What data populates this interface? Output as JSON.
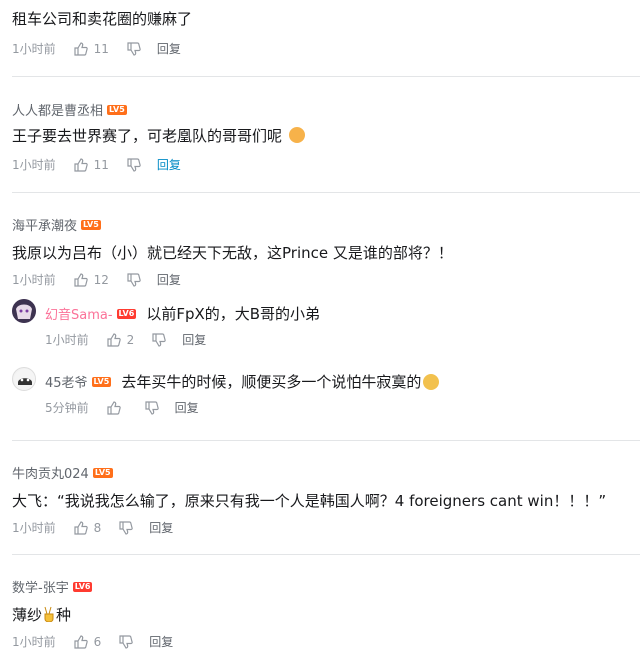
{
  "comments": [
    {
      "text": "租车公司和卖花圈的赚麻了",
      "time": "1小时前",
      "likes": "11",
      "reply": "回复"
    },
    {
      "username": "人人都是曹丞相",
      "level": "LV5",
      "text": "王子要去世界赛了，可老凰队的哥哥们呢",
      "time": "1小时前",
      "likes": "11",
      "reply": "回复"
    },
    {
      "username": "海平承潮夜",
      "level": "LV5",
      "text": "我原以为吕布（小）就已经天下无敌，这Prince 又是谁的部将？！",
      "time": "1小时前",
      "likes": "12",
      "reply": "回复",
      "replies": [
        {
          "username": "幻音Sama-",
          "level": "LV6",
          "text": "以前FpX的，大B哥的小弟",
          "time": "1小时前",
          "likes": "2",
          "reply": "回复"
        },
        {
          "username": "45老爷",
          "level": "LV5",
          "text": "去年买牛的时候，顺便买多一个说怕牛寂寞的",
          "time": "5分钟前",
          "reply": "回复"
        }
      ]
    },
    {
      "username": "牛肉贡丸024",
      "level": "LV5",
      "text": "大飞：“我说我怎么输了，原来只有我一个人是韩国人啊？4 foreigners cant win！！！”",
      "time": "1小时前",
      "likes": "8",
      "reply": "回复"
    },
    {
      "username": "数学-张宇",
      "level": "LV6",
      "text_before": "薄纱",
      "text_after": "种",
      "time": "1小时前",
      "likes": "6",
      "reply": "回复"
    }
  ],
  "colors": {
    "reply_active": "#008ac5",
    "meta": "#9499a0",
    "username": "#61666d",
    "sub_username": "#fb7299",
    "level5": "#ff6f1a",
    "level6": "#ff3b30"
  },
  "icons": [
    "thumb-up-icon",
    "thumb-down-icon",
    "emoji-icon",
    "victory-hand-emoji"
  ]
}
